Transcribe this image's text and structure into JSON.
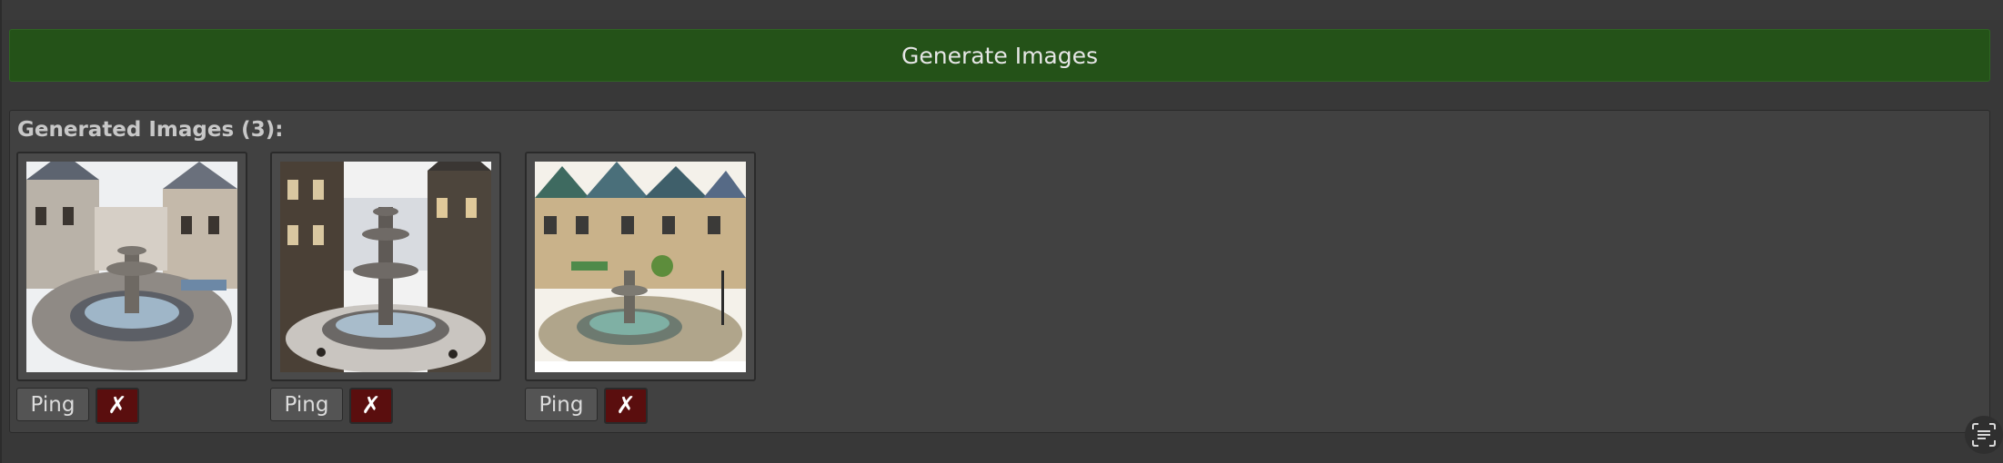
{
  "actions": {
    "generate_label": "Generate Images"
  },
  "gallery": {
    "title": "Generated Images (3):",
    "images": [
      {
        "ping_label": "Ping",
        "delete_label": "✗"
      },
      {
        "ping_label": "Ping",
        "delete_label": "✗"
      },
      {
        "ping_label": "Ping",
        "delete_label": "✗"
      }
    ]
  },
  "colors": {
    "background": "#383838",
    "generate_button": "#245218",
    "panel": "#414141",
    "delete_button": "#5a0e0e",
    "ping_button": "#545454"
  },
  "icons": {
    "corner": "scan-text-icon"
  }
}
